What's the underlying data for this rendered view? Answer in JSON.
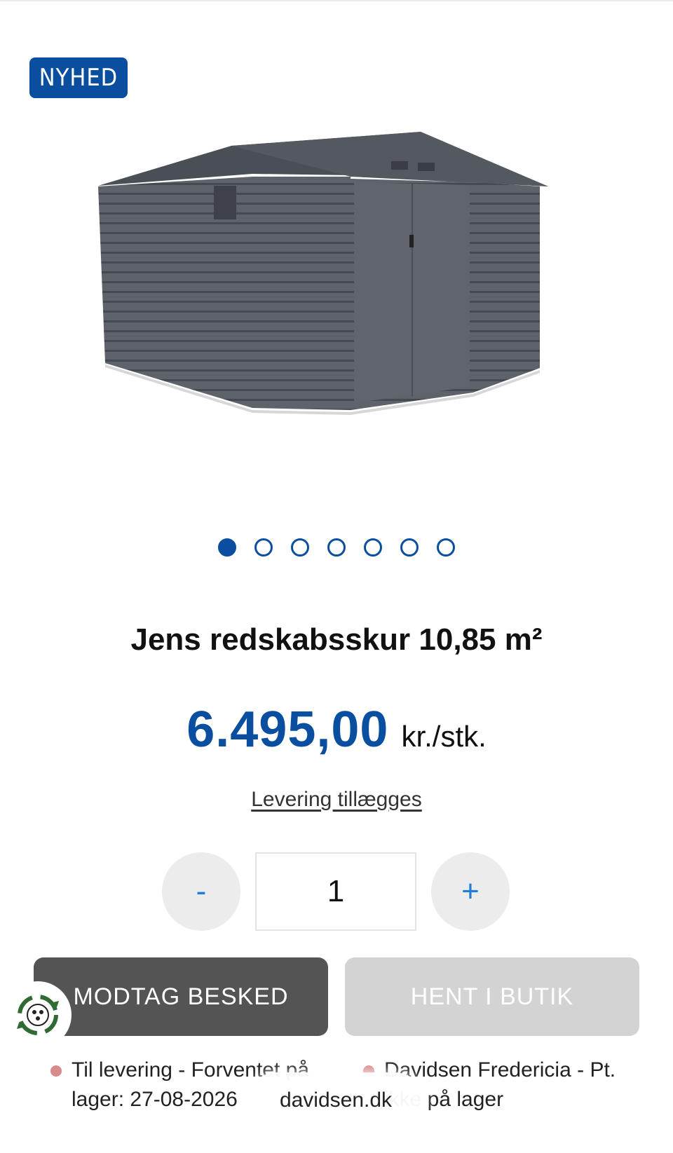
{
  "badge": {
    "label": "NYHED"
  },
  "gallery": {
    "dot_count": 7,
    "active_index": 0
  },
  "product": {
    "title": "Jens redskabsskur 10,85 m²",
    "price": "6.495,00",
    "unit": "kr./stk.",
    "delivery_link": "Levering tillægges"
  },
  "stepper": {
    "minus_label": "-",
    "quantity": "1",
    "plus_label": "+"
  },
  "actions": {
    "notify_label": "MODTAG BESKED",
    "pickup_label": "HENT I BUTIK"
  },
  "availability": {
    "delivery_text": "Til levering - Forventet på lager: 27-08-2026",
    "store_text": "Davidsen Fredericia - Pt. ikke på lager"
  },
  "browser": {
    "url": "davidsen.dk"
  },
  "colors": {
    "brand_blue": "#0a4ea0",
    "stepper_blue": "#1f7fd8",
    "notify_bg": "#545454",
    "pickup_bg": "#d3d3d3",
    "status_dot": "#d98b8b"
  },
  "icons": {
    "eco": "recycle-leaf-icon"
  }
}
